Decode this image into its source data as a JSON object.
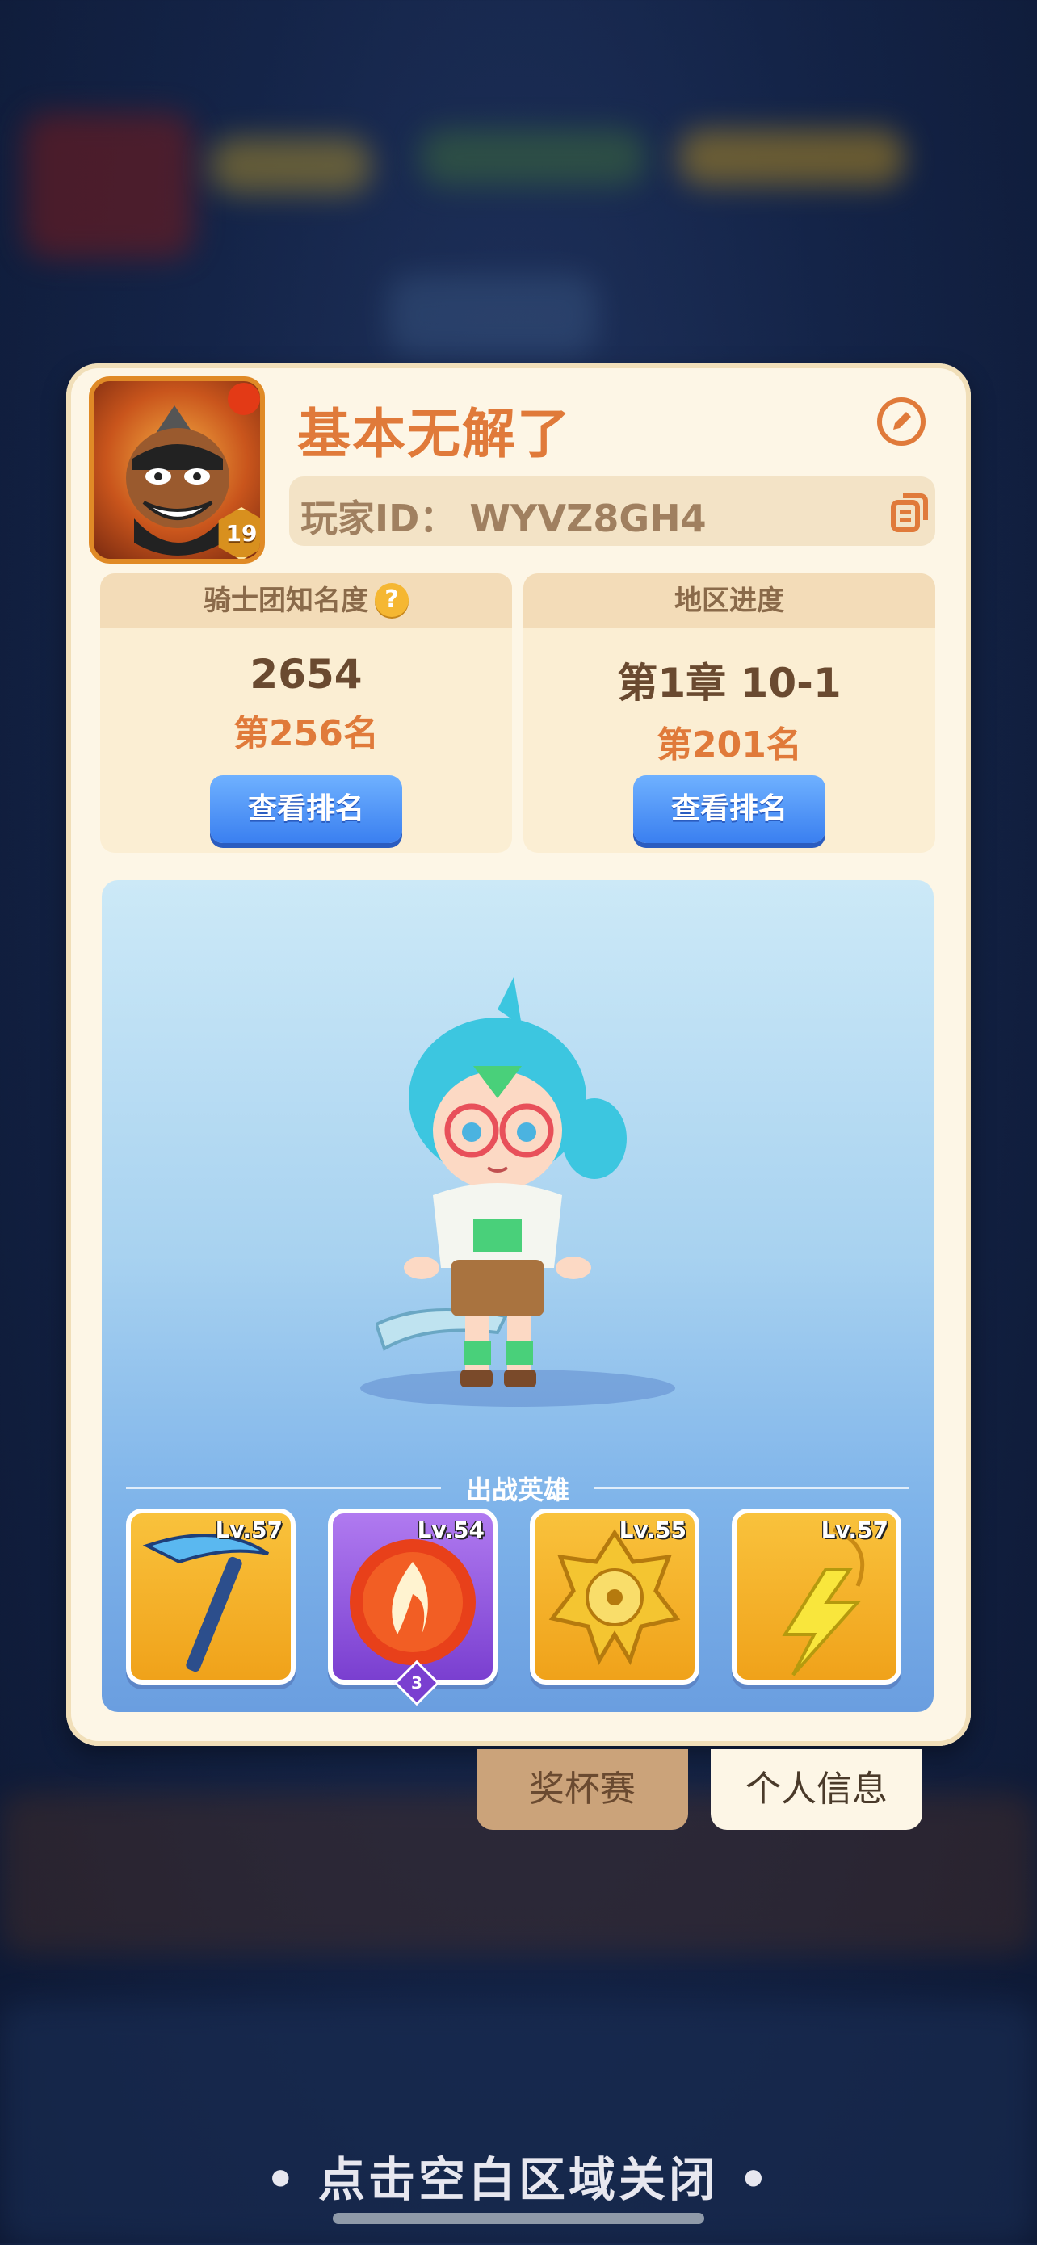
{
  "player": {
    "name": "基本无解了",
    "level": "19",
    "id_text": "玩家ID： WYVZ8GH4"
  },
  "stats": {
    "fame": {
      "label": "骑士团知名度",
      "value": "2654",
      "rank": "第256名",
      "button": "查看排名"
    },
    "region": {
      "label": "地区进度",
      "value": "第1章 10-1",
      "rank": "第201名",
      "button": "查看排名"
    }
  },
  "heroes_section": {
    "title": "出战英雄",
    "slots": [
      {
        "level": "Lv.57",
        "icon": "ice-pickaxe-icon",
        "frame_color": "#f5a623"
      },
      {
        "level": "Lv.54",
        "icon": "fire-orb-icon",
        "frame_color": "#8f4fe0",
        "badge": "3"
      },
      {
        "level": "Lv.55",
        "icon": "gold-spider-emblem-icon",
        "frame_color": "#f5a623"
      },
      {
        "level": "Lv.57",
        "icon": "lightning-pendant-icon",
        "frame_color": "#f5a623"
      }
    ]
  },
  "tabs": {
    "trophy": "奖杯赛",
    "profile": "个人信息"
  },
  "close_hint": "• 点击空白区域关闭 •",
  "colors": {
    "accent": "#e07a3a",
    "button_blue": "#3a7ff0",
    "panel_bg": "#fdf6e6"
  }
}
